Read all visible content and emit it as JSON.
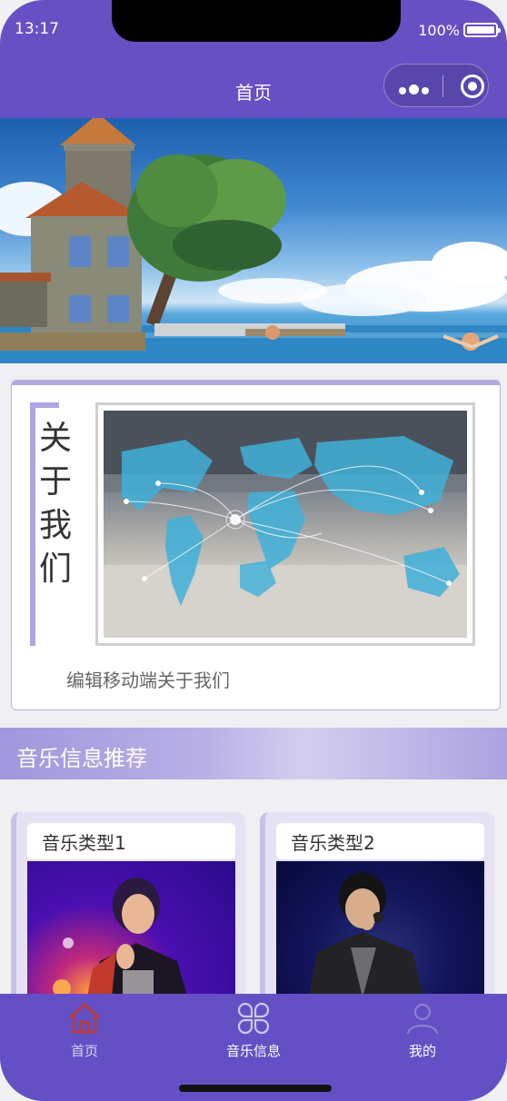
{
  "status": {
    "time": "13:17",
    "battery": "100%"
  },
  "navbar": {
    "title": "首页"
  },
  "about": {
    "title_chars": [
      "关",
      "于",
      "我",
      "们"
    ],
    "description": "编辑移动端关于我们"
  },
  "section": {
    "title": "音乐信息推荐"
  },
  "music_cards": [
    {
      "label": "音乐类型1"
    },
    {
      "label": "音乐类型2"
    }
  ],
  "tabbar": {
    "items": [
      {
        "label": "首页",
        "icon": "home-icon",
        "active": true
      },
      {
        "label": "音乐信息",
        "icon": "grid-flower-icon",
        "active": false
      },
      {
        "label": "我的",
        "icon": "person-icon",
        "active": false
      }
    ]
  },
  "colors": {
    "primary": "#6650c4",
    "accent": "#b0a5e2",
    "home_active": "#c0392b"
  }
}
